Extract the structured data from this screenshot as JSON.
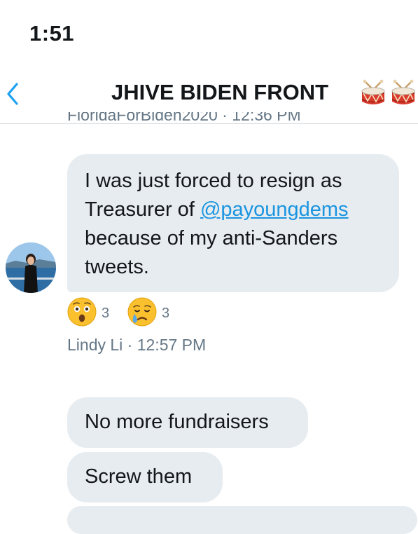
{
  "status_bar": {
    "time": "1:51"
  },
  "header": {
    "back_icon": "chevron-left-icon",
    "title": "JHIVE BIDEN FRONT",
    "title_emoji": [
      "drum-emoji",
      "drum-emoji"
    ]
  },
  "conversation": {
    "prev_meta": "FloridaForBiden2020 · 12:36 PM",
    "message_1": {
      "line_1": "I was just forced to resign as",
      "line_2_prefix": "Treasurer of ",
      "mention": "@payoungdems",
      "line_3": "because of my anti-Sanders",
      "line_4": "tweets.",
      "reactions": [
        {
          "icon": "astonished-face-emoji",
          "count": "3"
        },
        {
          "icon": "crying-face-emoji",
          "count": "3"
        }
      ],
      "meta": "Lindy Li · 12:57 PM"
    },
    "message_2": "No more fundraisers",
    "message_3": "Screw them"
  },
  "colors": {
    "bubble": "#e6ecf0",
    "link": "#1b95e0",
    "meta": "#657786",
    "back_chevron": "#1da1f2"
  }
}
